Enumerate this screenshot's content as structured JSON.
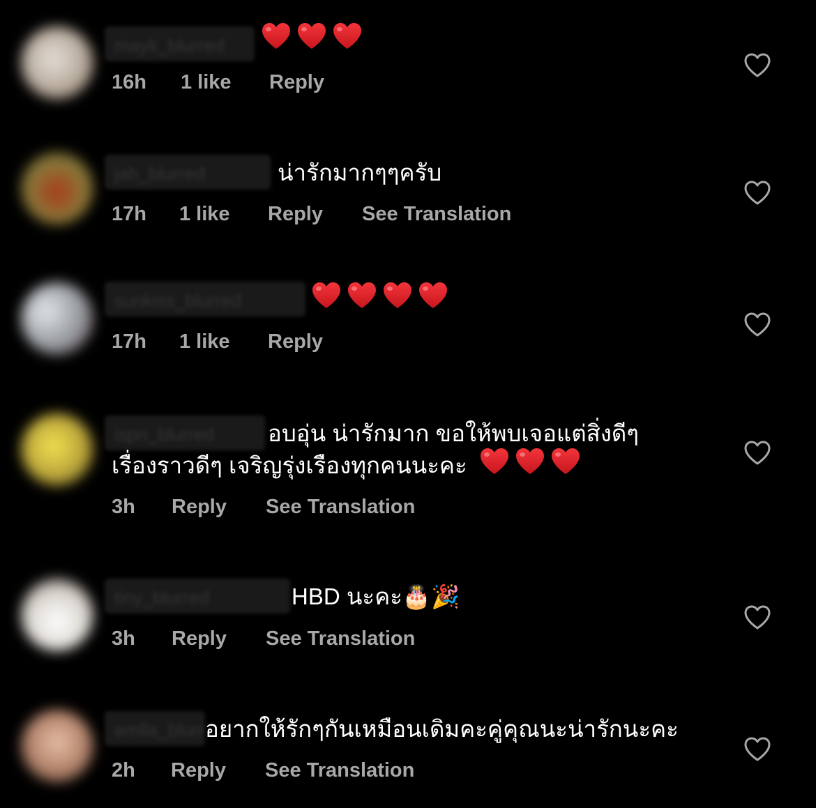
{
  "comments": [
    {
      "username": "mayk_blurred",
      "text": "",
      "hearts": 3,
      "time": "16h",
      "likes": "1 like",
      "reply": "Reply",
      "translation": "",
      "avatar_color": "#cfc7bd"
    },
    {
      "username": "jah_blurred",
      "text": "น่ารักมากๆๆครับ",
      "hearts": 0,
      "time": "17h",
      "likes": "1 like",
      "reply": "Reply",
      "translation": "See Translation",
      "avatar_color": "#8a6a2c"
    },
    {
      "username": "sunkiss_blurred",
      "text": "",
      "hearts": 4,
      "time": "17h",
      "likes": "1 like",
      "reply": "Reply",
      "translation": "",
      "avatar_color": "#a9aeb4"
    },
    {
      "username": "ispn_blurred",
      "text_line1": "อบอุ่น น่ารักมาก ขอให้พบเจอแต่สิ่งดีๆ",
      "text_line2": "เรื่องราวดีๆ เจริญรุ่งเรืองทุกคนนะคะ",
      "hearts": 3,
      "time": "3h",
      "reply": "Reply",
      "translation": "See Translation",
      "avatar_color": "#c9b236"
    },
    {
      "username": "tiny_blurred",
      "text": "HBD นะคะ🎂🎉",
      "hearts": 0,
      "time": "3h",
      "reply": "Reply",
      "translation": "See Translation",
      "avatar_color": "#e8e4df"
    },
    {
      "username": "amlla_blurred",
      "text": "อยากให้รักๆกันเหมือนเดิมคะคู่คุณนะน่ารักนะคะ",
      "hearts": 0,
      "time": "2h",
      "reply": "Reply",
      "translation": "See Translation",
      "avatar_color": "#c09278"
    }
  ],
  "icons": {
    "like": "heart-outline-icon",
    "emoji": "red-heart-emoji"
  },
  "colors": {
    "background": "#000000",
    "text": "#ffffff",
    "meta": "#a8a8a8",
    "heart_emoji": "#e8262d"
  }
}
